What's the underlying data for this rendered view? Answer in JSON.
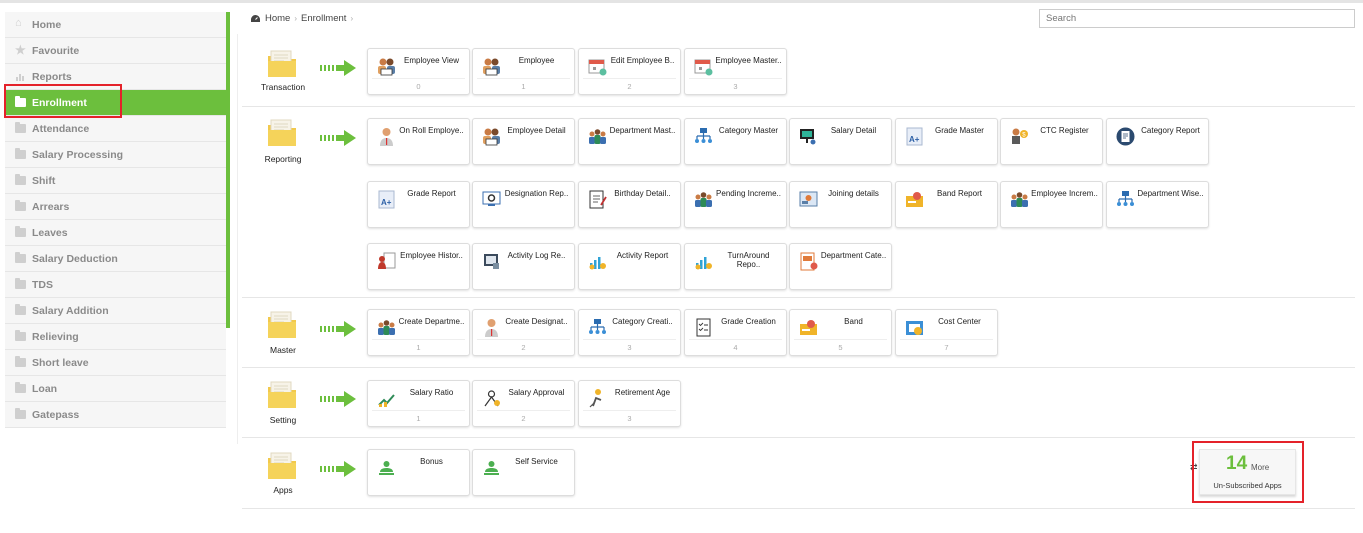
{
  "sidebar": {
    "items": [
      {
        "label": "Home",
        "icon": "home-icon"
      },
      {
        "label": "Favourite",
        "icon": "star-icon"
      },
      {
        "label": "Reports",
        "icon": "report-icon"
      },
      {
        "label": "Enrollment",
        "icon": "folder-icon",
        "active": true
      },
      {
        "label": "Attendance",
        "icon": "folder-icon"
      },
      {
        "label": "Salary Processing",
        "icon": "folder-icon"
      },
      {
        "label": "Shift",
        "icon": "folder-icon"
      },
      {
        "label": "Arrears",
        "icon": "folder-icon"
      },
      {
        "label": "Leaves",
        "icon": "folder-icon"
      },
      {
        "label": "Salary Deduction",
        "icon": "folder-icon"
      },
      {
        "label": "TDS",
        "icon": "folder-icon"
      },
      {
        "label": "Salary Addition",
        "icon": "folder-icon"
      },
      {
        "label": "Relieving",
        "icon": "folder-icon"
      },
      {
        "label": "Short leave",
        "icon": "folder-icon"
      },
      {
        "label": "Loan",
        "icon": "folder-icon"
      },
      {
        "label": "Gatepass",
        "icon": "folder-icon"
      }
    ]
  },
  "breadcrumb": {
    "home": "Home",
    "current": "Enrollment"
  },
  "search": {
    "placeholder": "Search"
  },
  "colors": {
    "accent": "#6cbf3d",
    "highlight": "#e4222a"
  },
  "sections": {
    "transaction": {
      "label": "Transaction",
      "tiles": [
        {
          "label": "Employee View",
          "num": "0",
          "icon": "employees-icon"
        },
        {
          "label": "Employee",
          "num": "1",
          "icon": "employees-icon"
        },
        {
          "label": "Edit Employee B..",
          "num": "2",
          "icon": "calendar-icon"
        },
        {
          "label": "Employee Master..",
          "num": "3",
          "icon": "calendar-icon"
        }
      ]
    },
    "reporting": {
      "label": "Reporting",
      "tiles": [
        {
          "label": "On Roll Employe..",
          "num": "",
          "icon": "person-icon"
        },
        {
          "label": "Employee Detail",
          "num": "",
          "icon": "employees-icon"
        },
        {
          "label": "Department Mast..",
          "num": "",
          "icon": "team-icon"
        },
        {
          "label": "Category Master",
          "num": "",
          "icon": "hierarchy-icon"
        },
        {
          "label": "Salary Detail",
          "num": "",
          "icon": "monitor-icon"
        },
        {
          "label": "Grade Master",
          "num": "",
          "icon": "grade-icon"
        },
        {
          "label": "CTC Register",
          "num": "",
          "icon": "ctc-icon"
        },
        {
          "label": "Category Report",
          "num": "",
          "icon": "report-circle-icon"
        },
        {
          "label": "Grade Report",
          "num": "",
          "icon": "grade-icon"
        },
        {
          "label": "Designation Rep..",
          "num": "",
          "icon": "gear-monitor-icon"
        },
        {
          "label": "Birthday Detail..",
          "num": "",
          "icon": "document-icon"
        },
        {
          "label": "Pending Increme..",
          "num": "",
          "icon": "team-icon"
        },
        {
          "label": "Joining details",
          "num": "",
          "icon": "joining-icon"
        },
        {
          "label": "Band Report",
          "num": "",
          "icon": "band-icon"
        },
        {
          "label": "Employee Increm..",
          "num": "",
          "icon": "team-icon"
        },
        {
          "label": "Department Wise..",
          "num": "",
          "icon": "hierarchy-icon"
        },
        {
          "label": "Employee Histor..",
          "num": "",
          "icon": "history-icon"
        },
        {
          "label": "Activity Log Re..",
          "num": "",
          "icon": "log-icon"
        },
        {
          "label": "Activity Report",
          "num": "",
          "icon": "activity-icon"
        },
        {
          "label": "TurnAround Repo..",
          "num": "",
          "icon": "activity-icon"
        },
        {
          "label": "Department Cate..",
          "num": "",
          "icon": "dept-cat-icon"
        }
      ]
    },
    "master": {
      "label": "Master",
      "tiles": [
        {
          "label": "Create Departme..",
          "num": "1",
          "icon": "team-icon"
        },
        {
          "label": "Create Designat..",
          "num": "2",
          "icon": "person-icon"
        },
        {
          "label": "Category Creati..",
          "num": "3",
          "icon": "hierarchy-icon"
        },
        {
          "label": "Grade Creation",
          "num": "4",
          "icon": "checklist-icon"
        },
        {
          "label": "Band",
          "num": "5",
          "icon": "band-icon"
        },
        {
          "label": "Cost Center",
          "num": "7",
          "icon": "cost-icon"
        }
      ]
    },
    "setting": {
      "label": "Setting",
      "tiles": [
        {
          "label": "Salary Ratio",
          "num": "1",
          "icon": "ratio-icon"
        },
        {
          "label": "Salary Approval",
          "num": "2",
          "icon": "approval-icon"
        },
        {
          "label": "Retirement Age",
          "num": "3",
          "icon": "retire-icon"
        }
      ]
    },
    "apps": {
      "label": "Apps",
      "tiles": [
        {
          "label": "Bonus",
          "num": "",
          "icon": "user-green-icon"
        },
        {
          "label": "Self Service",
          "num": "",
          "icon": "user-green-icon"
        }
      ]
    }
  },
  "more": {
    "count": "14",
    "word": "More",
    "caption": "Un-Subscribed Apps"
  }
}
